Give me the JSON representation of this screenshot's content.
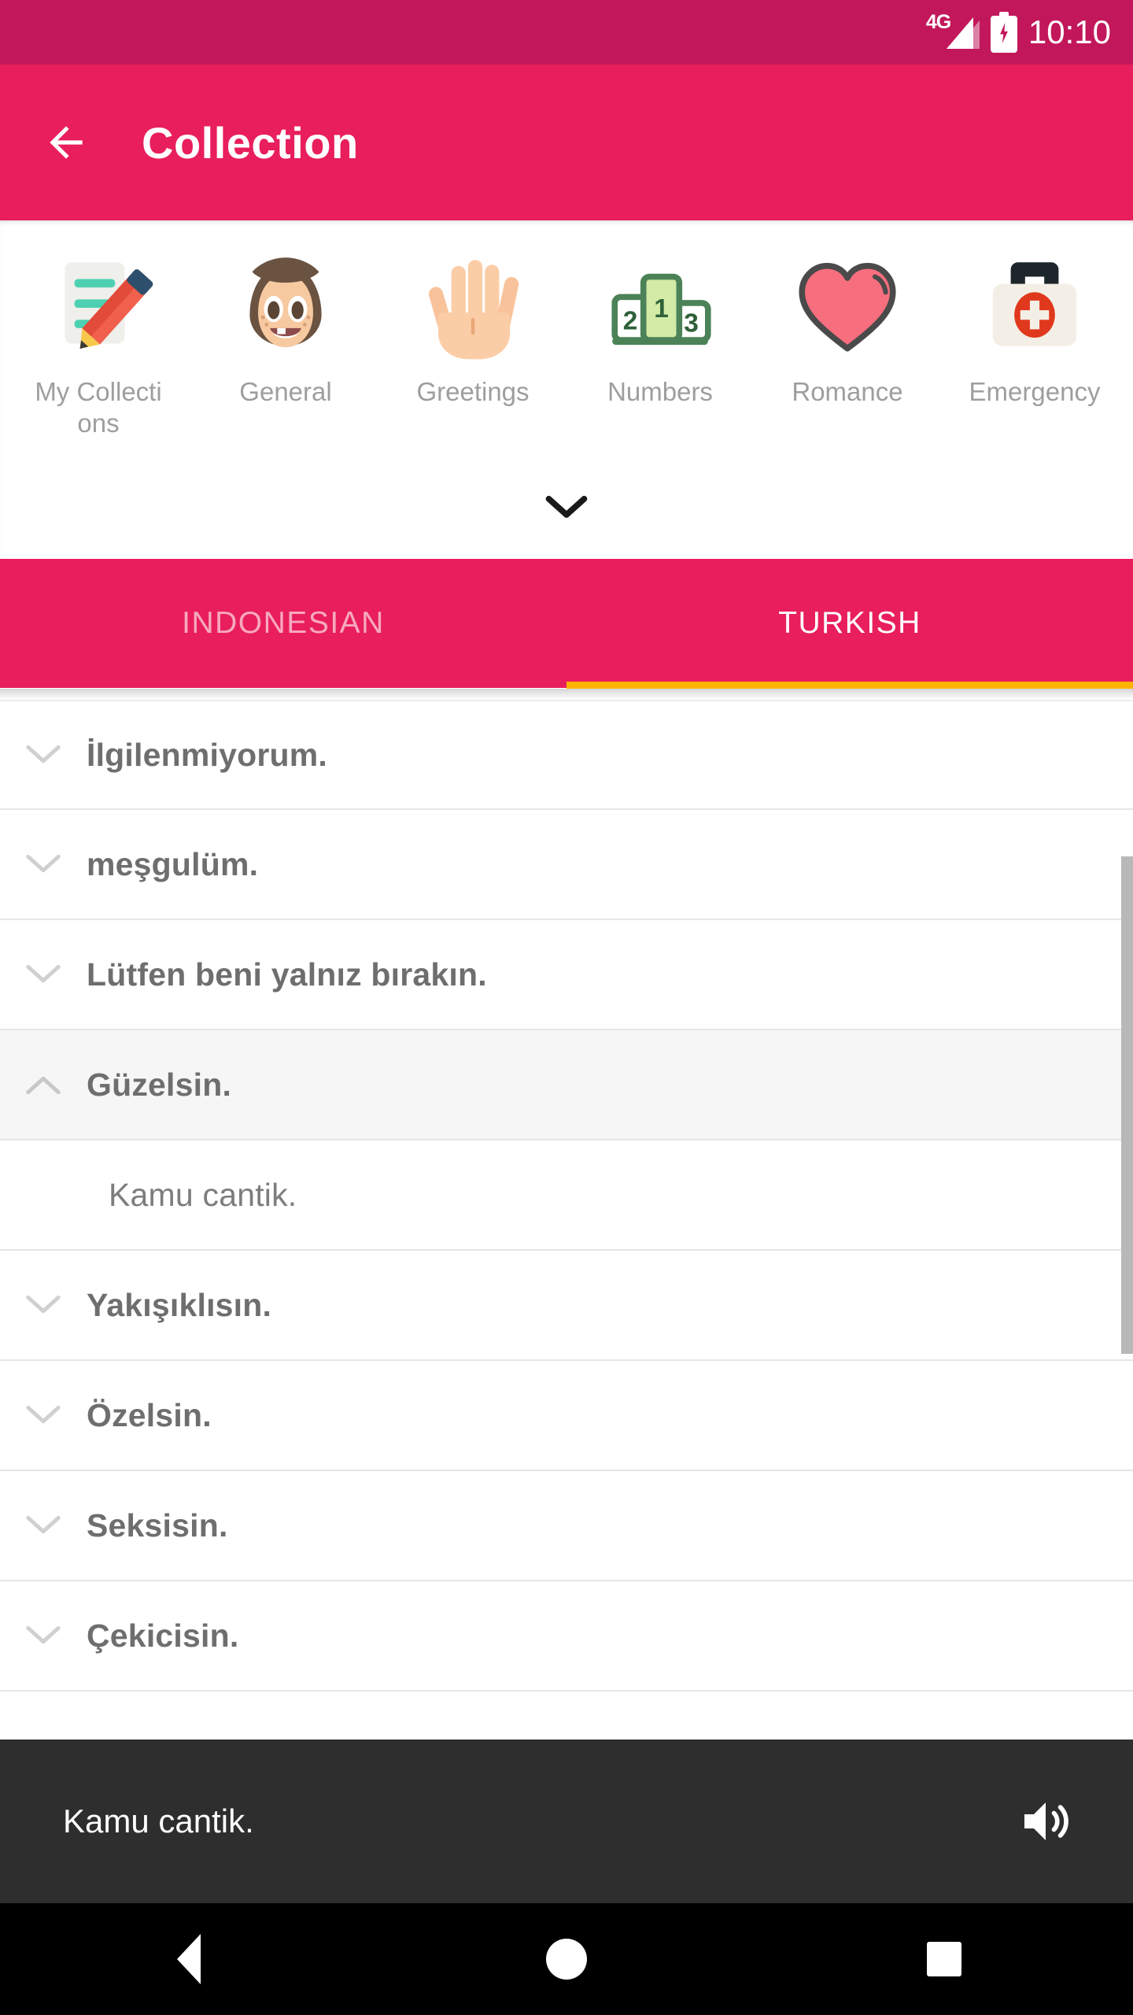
{
  "status_bar": {
    "network_label": "4G",
    "time": "10:10",
    "battery_icon": "battery-charging-icon",
    "signal_icon": "signal-bars-icon"
  },
  "app_bar": {
    "back_icon": "arrow-left-icon",
    "title": "Collection",
    "background": "#E91E5C"
  },
  "categories": {
    "expand_icon": "chevron-down-icon",
    "items": [
      {
        "label": "My Collections",
        "icon": "notepad-pencil-icon"
      },
      {
        "label": "General",
        "icon": "girl-face-icon"
      },
      {
        "label": "Greetings",
        "icon": "open-hand-icon"
      },
      {
        "label": "Numbers",
        "icon": "podium-123-icon"
      },
      {
        "label": "Romance",
        "icon": "heart-icon"
      },
      {
        "label": "Emergency",
        "icon": "first-aid-kit-icon"
      }
    ]
  },
  "tabs": {
    "indicator_color": "#FFB300",
    "items": [
      {
        "label": "INDONESIAN",
        "active": false
      },
      {
        "label": "TURKISH",
        "active": true
      }
    ]
  },
  "list": {
    "chevron_down_icon": "chevron-down-icon",
    "chevron_up_icon": "chevron-up-icon",
    "rows": [
      {
        "phrase": "İlgilenmiyorum.",
        "expanded": false
      },
      {
        "phrase": "meşgulüm.",
        "expanded": false
      },
      {
        "phrase": "Lütfen beni yalnız bırakın.",
        "expanded": false
      },
      {
        "phrase": "Güzelsin.",
        "expanded": true
      },
      {
        "phrase": "Yakışıklısın.",
        "expanded": false
      },
      {
        "phrase": "Özelsin.",
        "expanded": false
      },
      {
        "phrase": "Seksisin.",
        "expanded": false
      },
      {
        "phrase": "Çekicisin.",
        "expanded": false
      }
    ],
    "translation": "Kamu cantik."
  },
  "player_bar": {
    "text": "Kamu cantik.",
    "speaker_icon": "speaker-volume-icon",
    "background": "#2E2E2E"
  },
  "nav_bar": {
    "back": "nav-back-icon",
    "home": "nav-home-icon",
    "recents": "nav-recents-icon"
  }
}
